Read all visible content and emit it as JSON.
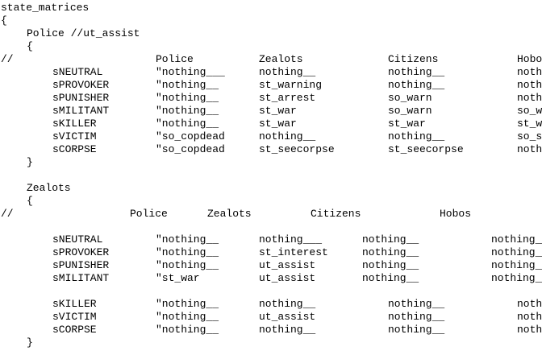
{
  "editor": {
    "lines": [
      {
        "segs": [
          "state_matrices"
        ]
      },
      {
        "segs": [
          "{"
        ]
      },
      {
        "segs": [
          "Police //ut_assist"
        ]
      },
      {
        "segs": [
          "{"
        ]
      },
      {
        "segs": [
          "//",
          "Police",
          "Zealots",
          "Citizens",
          "Hobos"
        ]
      },
      {
        "segs": [
          "sNEUTRAL",
          "\"nothing___",
          "nothing__",
          "nothing__",
          "nothing__"
        ]
      },
      {
        "segs": [
          "sPROVOKER",
          "\"nothing__",
          "st_warning",
          "nothing__",
          "nothing__"
        ]
      },
      {
        "segs": [
          "sPUNISHER",
          "\"nothing__",
          "st_arrest",
          "so_warn",
          "nothing__"
        ]
      },
      {
        "segs": [
          "sMILITANT",
          "\"nothing__",
          "st_war",
          "so_warn",
          "so_warn"
        ]
      },
      {
        "segs": [
          "sKILLER",
          "\"nothing__",
          "st_war",
          "st_war",
          "st_war"
        ]
      },
      {
        "segs": [
          "sVICTIM",
          "\"so_copdead",
          "nothing__",
          "nothing__",
          "so_sad"
        ]
      },
      {
        "segs": [
          "sCORPSE",
          "\"so_copdead",
          "st_seecorpse",
          "st_seecorpse",
          "nothing__"
        ]
      },
      {
        "segs": [
          "}"
        ]
      },
      {
        "segs": [
          "Zealots"
        ]
      },
      {
        "segs": [
          "{"
        ]
      },
      {
        "segs": [
          "//",
          "Police",
          "Zealots",
          "Citizens",
          "Hobos"
        ]
      },
      {
        "segs": [
          "sNEUTRAL",
          "\"nothing__",
          "nothing___",
          "nothing__",
          "nothing__"
        ]
      },
      {
        "segs": [
          "sPROVOKER",
          "\"nothing__",
          "st_interest",
          "nothing__",
          "nothing__"
        ]
      },
      {
        "segs": [
          "sPUNISHER",
          "\"nothing__",
          "ut_assist",
          "nothing__",
          "nothing__"
        ]
      },
      {
        "segs": [
          "sMILITANT",
          "\"st_war",
          "ut_assist",
          "nothing__",
          "nothing__"
        ]
      },
      {
        "segs": [
          "sKILLER",
          "\"nothing__",
          "nothing__",
          "nothing__",
          "nothing__"
        ]
      },
      {
        "segs": [
          "sVICTIM",
          "\"nothing__",
          "ut_assist",
          "nothing__",
          "nothing__"
        ]
      },
      {
        "segs": [
          "sCORPSE",
          "\"nothing__",
          "nothing__",
          "nothing__",
          "nothing__"
        ]
      },
      {
        "segs": [
          "}"
        ]
      }
    ]
  }
}
